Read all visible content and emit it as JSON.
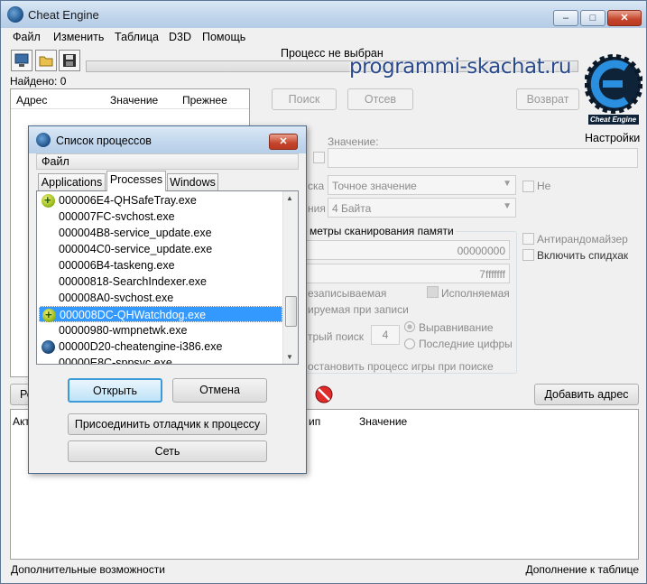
{
  "window": {
    "title": "Cheat Engine",
    "min": "‒",
    "max": "□",
    "close": "✕"
  },
  "menu": [
    "Файл",
    "Изменить",
    "Таблица",
    "D3D",
    "Помощь"
  ],
  "toolbar": {
    "process_label": "Процесс не выбран",
    "found": "Найдено: 0"
  },
  "watermark": "programmi-skachat.ru",
  "logo_text": "Cheat Engine",
  "settings": "Настройки",
  "addr_headers": [
    "Адрес",
    "Значение",
    "Прежнее"
  ],
  "scan": {
    "first": "Поиск",
    "next": "Отсев",
    "undo": "Возврат",
    "value_label": "Значение:",
    "scan_type_partial": "ска",
    "scan_type": "Точное значение",
    "value_type_partial": "ния",
    "value_type": "4 Байта",
    "not_label": "Не",
    "mem_opts": "метры сканирования памяти",
    "start": "00000000",
    "stop": "7fffffff",
    "writable": "езаписываемая",
    "executable": "Исполняемая",
    "cow": "ируемая при записи",
    "fast_scan": "трый поиск",
    "fast_value": "4",
    "alignment": "Выравнивание",
    "last_digits": "Последние цифры",
    "pause": "остановить процесс игры при поиске",
    "antirandom": "Антирандомайзер",
    "speedhack": "Включить спидхак"
  },
  "add_address": "Добавить адрес",
  "bottom_headers": {
    "active_partial": "Акт",
    "type_partial": "ип",
    "value": "Значение"
  },
  "left_btn_partial": "Ре",
  "status": {
    "left": "Дополнительные возможности",
    "right": "Дополнение к таблице"
  },
  "dialog": {
    "title": "Список процессов",
    "menu": "Файл",
    "tabs": [
      "Applications",
      "Processes",
      "Windows"
    ],
    "processes": [
      {
        "name": "000006E4-QHSafeTray.exe",
        "icon": "qh-icon"
      },
      {
        "name": "000007FC-svchost.exe",
        "icon": ""
      },
      {
        "name": "000004B8-service_update.exe",
        "icon": ""
      },
      {
        "name": "000004C0-service_update.exe",
        "icon": ""
      },
      {
        "name": "000006B4-taskeng.exe",
        "icon": ""
      },
      {
        "name": "00000818-SearchIndexer.exe",
        "icon": ""
      },
      {
        "name": "000008A0-svchost.exe",
        "icon": ""
      },
      {
        "name": "000008DC-QHWatchdog.exe",
        "icon": "qh-icon"
      },
      {
        "name": "00000980-wmpnetwk.exe",
        "icon": ""
      },
      {
        "name": "00000D20-cheatengine-i386.exe",
        "icon": "ce-icon"
      },
      {
        "name": "00000E8C-sppsvc.exe",
        "icon": ""
      }
    ],
    "selected_index": 7,
    "open": "Открыть",
    "cancel": "Отмена",
    "attach": "Присоединить отладчик к процессу",
    "network": "Сеть"
  }
}
